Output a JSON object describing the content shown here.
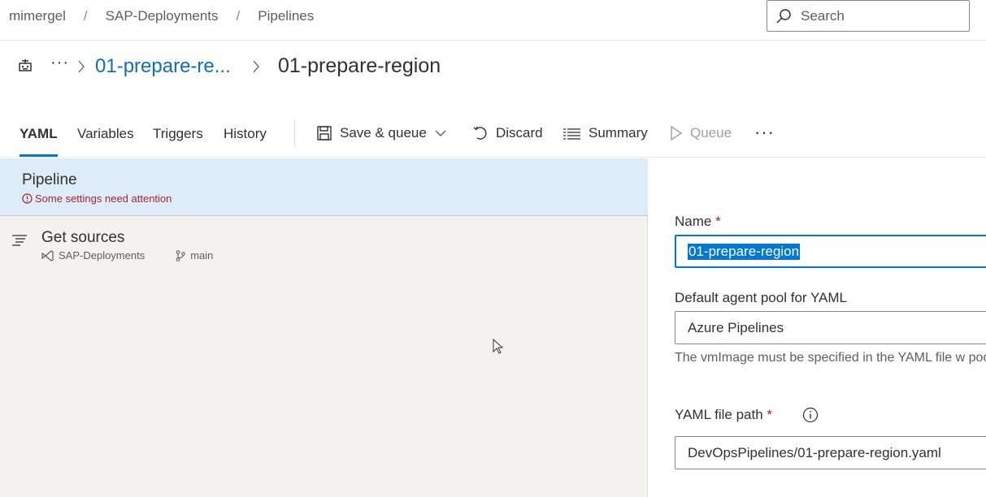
{
  "breadcrumbs": [
    "mimergel",
    "SAP-Deployments",
    "Pipelines"
  ],
  "search": {
    "placeholder": "Search"
  },
  "title_row": {
    "more": "···",
    "parent_link": "01-prepare-re...",
    "current": "01-prepare-region"
  },
  "tabs": [
    {
      "label": "YAML",
      "active": true
    },
    {
      "label": "Variables"
    },
    {
      "label": "Triggers"
    },
    {
      "label": "History"
    }
  ],
  "toolbar": {
    "save_queue": "Save & queue",
    "discard": "Discard",
    "summary": "Summary",
    "queue": "Queue",
    "more": "···"
  },
  "pipeline": {
    "title": "Pipeline",
    "warning": "Some settings need attention"
  },
  "get_sources": {
    "title": "Get sources",
    "repo": "SAP-Deployments",
    "branch": "main"
  },
  "form": {
    "name_label": "Name",
    "required_mark": "*",
    "name_value": "01-prepare-region",
    "pool_label": "Default agent pool for YAML",
    "pool_value": "Azure Pipelines",
    "pool_hint": "The vmImage must be specified in the YAML file w pool.",
    "yaml_label": "YAML file path",
    "yaml_value": "DevOpsPipelines/01-prepare-region.yaml"
  },
  "colors": {
    "accent": "#0078d4",
    "error": "#a4262c",
    "selected_bg": "#deecf9"
  }
}
